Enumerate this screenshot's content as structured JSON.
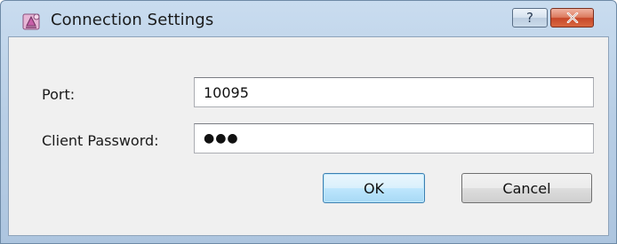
{
  "window": {
    "title": "Connection Settings",
    "help_glyph": "?",
    "icons": {
      "app": "connection-app-icon",
      "close": "close-icon"
    }
  },
  "form": {
    "port": {
      "label": "Port:",
      "value": "10095"
    },
    "password": {
      "label": "Client Password:",
      "masked_value": "●●●"
    }
  },
  "buttons": {
    "ok_label": "OK",
    "cancel_label": "Cancel"
  },
  "colors": {
    "titlebar": "#b9cfe6",
    "dialog_body": "#f0f0f0",
    "ok_border": "#3c7fb1",
    "close_button": "#c7482a"
  }
}
